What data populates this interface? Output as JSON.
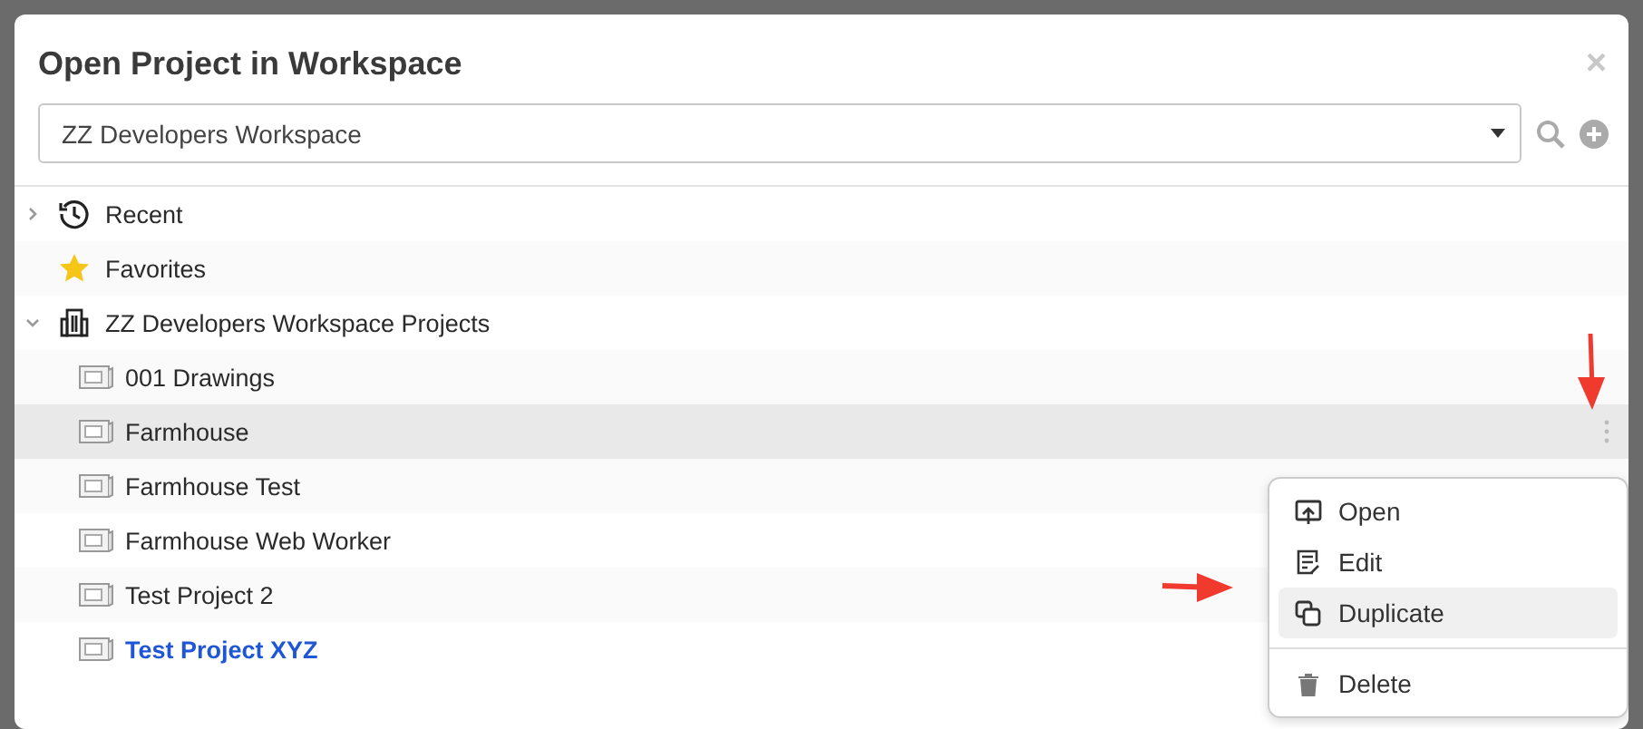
{
  "dialog": {
    "title": "Open Project in Workspace",
    "close": "×"
  },
  "workspace_select": {
    "value": "ZZ Developers Workspace"
  },
  "tree": [
    {
      "label": "Recent",
      "kind": "recent",
      "expanded": false
    },
    {
      "label": "Favorites",
      "kind": "favorites"
    },
    {
      "label": "ZZ Developers Workspace Projects",
      "kind": "workspace",
      "expanded": true,
      "children": [
        {
          "label": "001 Drawings",
          "selected": false,
          "current": false
        },
        {
          "label": "Farmhouse",
          "selected": true,
          "current": false
        },
        {
          "label": "Farmhouse Test",
          "selected": false,
          "current": false
        },
        {
          "label": "Farmhouse Web Worker",
          "selected": false,
          "current": false
        },
        {
          "label": "Test Project 2",
          "selected": false,
          "current": false
        },
        {
          "label": "Test Project XYZ",
          "selected": false,
          "current": true
        }
      ]
    }
  ],
  "context_menu": [
    {
      "label": "Open",
      "kind": "open",
      "highlighted": false,
      "divider_before": false
    },
    {
      "label": "Edit",
      "kind": "edit",
      "highlighted": false,
      "divider_before": false
    },
    {
      "label": "Duplicate",
      "kind": "duplicate",
      "highlighted": true,
      "divider_before": false
    },
    {
      "label": "Delete",
      "kind": "delete",
      "highlighted": false,
      "divider_before": true
    }
  ]
}
